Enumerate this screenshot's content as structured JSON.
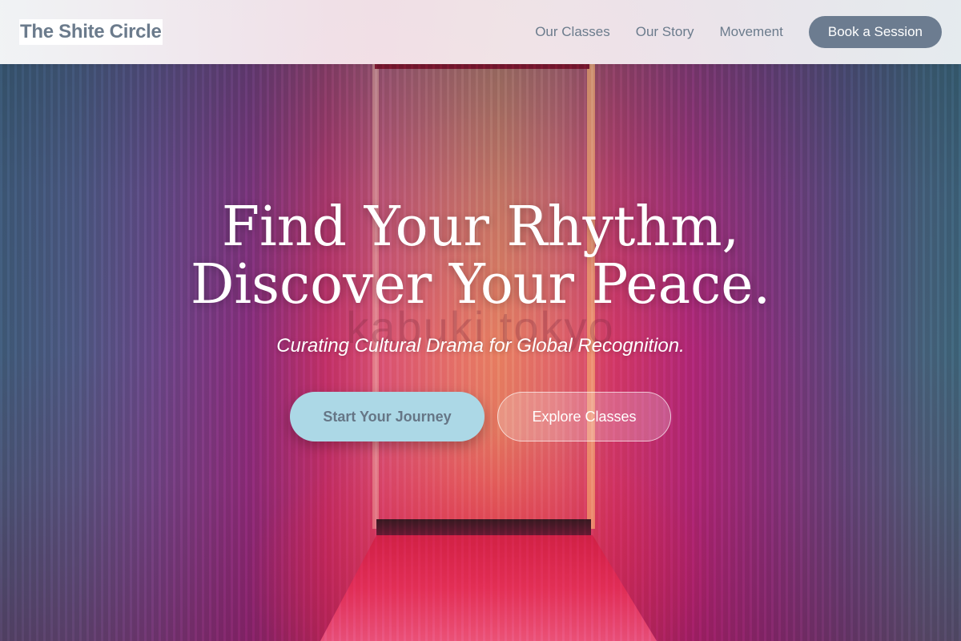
{
  "header": {
    "brand": "The Shite Circle",
    "nav": [
      {
        "label": "Our Classes"
      },
      {
        "label": "Our Story"
      },
      {
        "label": "Movement"
      }
    ],
    "cta_label": "Book a Session"
  },
  "hero": {
    "headline_line1": "Find Your Rhythm,",
    "headline_line2": "Discover Your Peace.",
    "watermark": "kabuki tokyo",
    "tagline": "Curating Cultural Drama for Global Recognition.",
    "primary_button": "Start Your Journey",
    "secondary_button": "Explore Classes"
  },
  "colors": {
    "nav_text": "#6b7b8c",
    "cta_bg": "#6c7c90",
    "primary_button_bg": "#acd8e6",
    "hero_white": "#ffffff"
  }
}
